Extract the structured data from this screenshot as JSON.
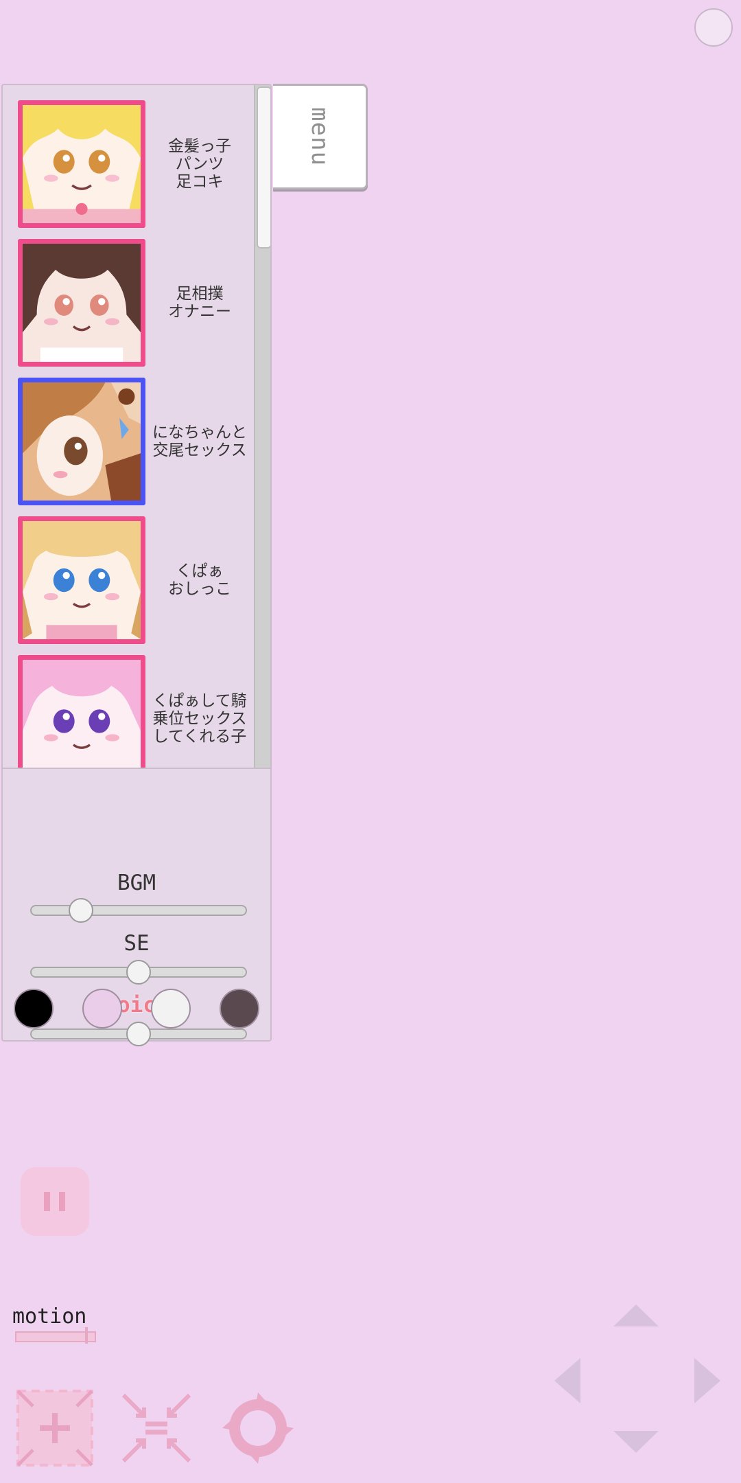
{
  "menu_tab": {
    "label": "menu"
  },
  "character_list": [
    {
      "label": "金髪っ子\nパンツ\n足コキ",
      "frame_color": "#ee4c8a"
    },
    {
      "label": "足相撲\nオナニー",
      "frame_color": "#ee4c8a"
    },
    {
      "label": "になちゃんと\n交尾セックス",
      "frame_color": "#4b53f2"
    },
    {
      "label": "くぱぁ\nおしっこ",
      "frame_color": "#ee4c8a"
    },
    {
      "label": "くぱぁして騎\n乗位セックス\nしてくれる子",
      "frame_color": "#ee4c8a"
    }
  ],
  "sound": {
    "bgm": {
      "label": "BGM",
      "level": 0.23
    },
    "se": {
      "label": "SE",
      "level": 0.5
    },
    "voice": {
      "label": "Voice",
      "level": 0.5
    }
  },
  "swatches": [
    "#000000",
    "#e9cde9",
    "#f2f2f2",
    "#5a4a4f"
  ],
  "motion": {
    "label": "motion"
  },
  "colors": {
    "background": "#efd3f1",
    "panel": "#e7d8e9",
    "accent_pink": "#ee4c8a",
    "accent_blue": "#4b53f2"
  },
  "icons": [
    "pause-icon",
    "zoom-in-icon",
    "zoom-out-icon",
    "rotate-icon",
    "arrow-up-icon",
    "arrow-left-icon",
    "arrow-right-icon",
    "arrow-down-icon"
  ]
}
